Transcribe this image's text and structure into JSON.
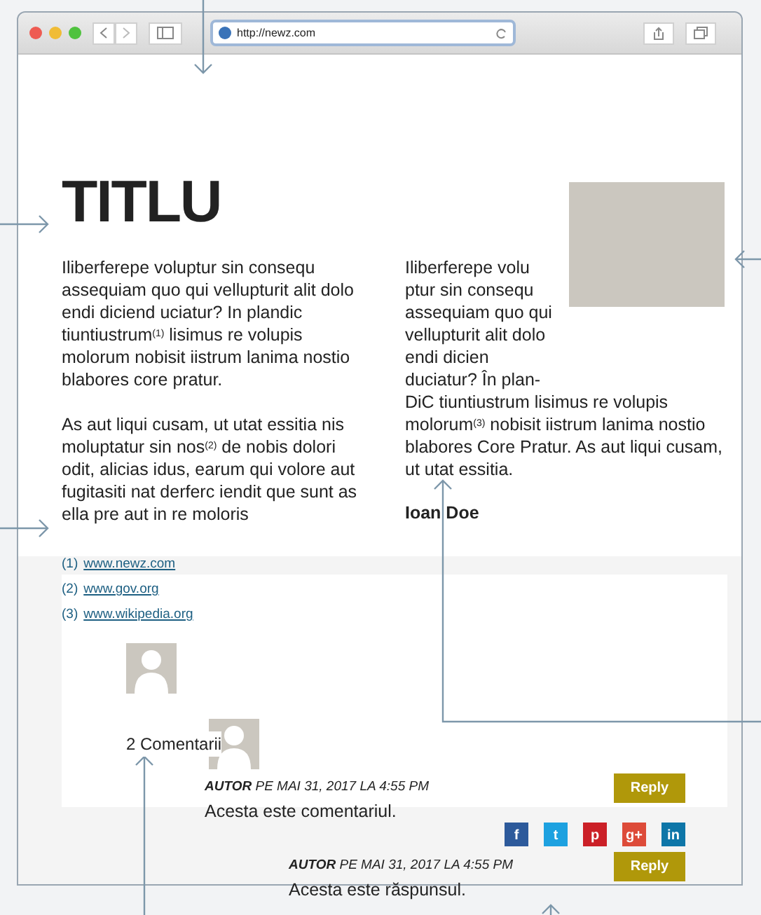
{
  "browser": {
    "url": "http://newz.com"
  },
  "article": {
    "title": "TITLU",
    "left_paragraphs": [
      "Iliberferepe voluptur sin consequ assequiam quo qui vellupturit alit dolo endi diciend uciatur? In plandic tiuntiustrum$^{(1)}$ lisimus re volupis molorum nobisit iistrum lanima nostio blabores core pratur.",
      "As aut liqui cusam, ut utat essitia nis moluptatur sin nos$^{(2)}$ de nobis dolori odit, alicias idus, earum qui volore aut fugitasiti nat derferc iendit que sunt as ella pre aut in re moloris"
    ],
    "right_paragraph_top": "Iliberferepe volu ptur sin consequ assequiam quo qui vellupturit alit dolo endi dicien duciatur? În plan-",
    "right_paragraph_bottom": "DiC tiuntiustrum lisimus re volupis molorum$^{(3)}$ nobisit iistrum lanima nostio blabores Core Pratur. As aut liqui cusam, ut utat essitia.",
    "author": "Ioan Doe",
    "footnotes": [
      {
        "number": "(1)",
        "link": "www.newz.com"
      },
      {
        "number": "(2)",
        "link": "www.gov.org"
      },
      {
        "number": "(3)",
        "link": "www.wikipedia.org"
      }
    ]
  },
  "comments": {
    "count": "2 Comentarii",
    "items": [
      {
        "author": "AUTOR",
        "meta": "PE MAI 31, 2017 LA 4:55 PM",
        "text": "Acesta este comentariul.",
        "reply": "Reply"
      },
      {
        "author": "AUTOR",
        "meta": "PE MAI 31, 2017 LA 4:55 PM",
        "text": "Acesta este răspunsul.",
        "reply": "Reply"
      }
    ],
    "share": [
      "f",
      "t",
      "p",
      "g+",
      "in"
    ]
  }
}
